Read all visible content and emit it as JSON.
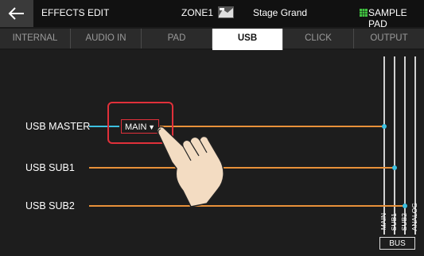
{
  "header": {
    "title": "EFFECTS EDIT",
    "zone": "ZONE1",
    "kit_name": "Stage Grand",
    "pad_label": "SAMPLE PAD"
  },
  "tabs": [
    {
      "label": "INTERNAL",
      "active": false
    },
    {
      "label": "AUDIO IN",
      "active": false
    },
    {
      "label": "PAD",
      "active": false
    },
    {
      "label": "USB",
      "active": true
    },
    {
      "label": "CLICK",
      "active": false
    },
    {
      "label": "OUTPUT",
      "active": false
    }
  ],
  "rows": [
    {
      "label": "USB MASTER",
      "dropdown_value": "MAIN"
    },
    {
      "label": "USB SUB1"
    },
    {
      "label": "USB SUB2"
    }
  ],
  "bus": {
    "label": "BUS",
    "lanes": [
      "MAIN",
      "SUB1",
      "SUB2",
      "ANALOG"
    ]
  },
  "colors": {
    "accent_orange": "#e8913a",
    "accent_cyan": "#3cc0e0",
    "highlight_red": "#e0303a"
  },
  "icons": [
    "back-arrow-icon",
    "kit-image-icon",
    "grid-icon",
    "dropdown-arrow-icon",
    "pointing-hand-icon"
  ]
}
